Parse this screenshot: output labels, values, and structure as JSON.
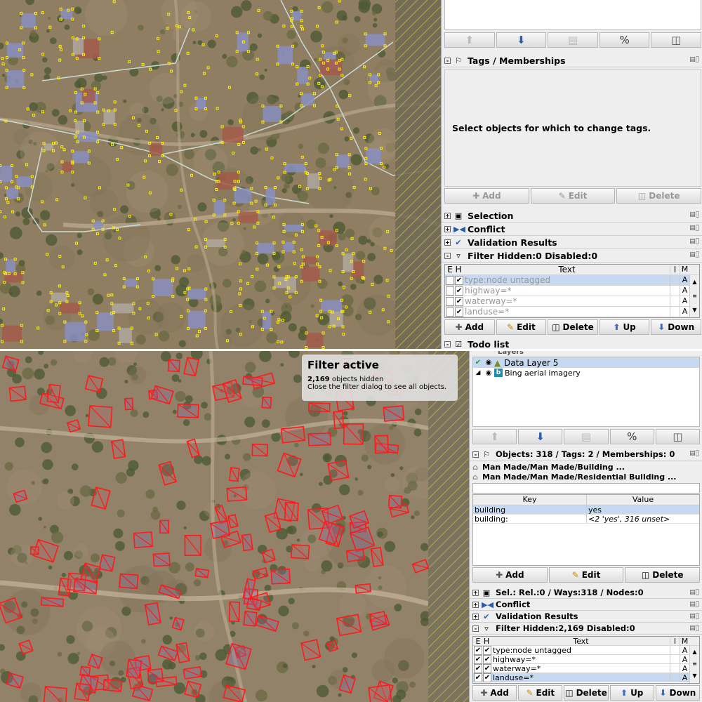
{
  "top": {
    "toolbar": [
      "up-arrow",
      "down-arrow",
      "merge",
      "percent",
      "trash"
    ],
    "tags_header": "Tags / Memberships",
    "tags_message": "Select objects for which to change tags.",
    "tags_buttons": {
      "add": "Add",
      "edit": "Edit",
      "delete": "Delete"
    },
    "dialogs": [
      {
        "label": "Selection",
        "icon": "selection-icon"
      },
      {
        "label": "Conflict",
        "icon": "conflict-icon"
      },
      {
        "label": "Validation Results",
        "icon": "check-icon"
      },
      {
        "label": "Filter Hidden:0 Disabled:0",
        "icon": "filter-icon"
      }
    ],
    "filter_cols": {
      "e": "E",
      "h": "H",
      "text": "Text",
      "i": "I",
      "m": "M"
    },
    "filters": [
      {
        "text": "type:node untagged",
        "m": "A"
      },
      {
        "text": "highway=*",
        "m": "A"
      },
      {
        "text": "waterway=*",
        "m": "A"
      },
      {
        "text": "landuse=*",
        "m": "A"
      }
    ],
    "filter_buttons": {
      "add": "Add",
      "edit": "Edit",
      "delete": "Delete",
      "up": "Up",
      "down": "Down"
    },
    "todo": "Todo list"
  },
  "bottom": {
    "tooltip": {
      "title": "Filter active",
      "count": "2,169",
      "count_suffix": "objects hidden",
      "hint": "Close the filter dialog to see all objects."
    },
    "layers_header": "Layers",
    "layers": [
      {
        "name": "Data Layer 5"
      },
      {
        "name": "Bing aerial imagery"
      }
    ],
    "toolbar": [
      "up-arrow",
      "down-arrow",
      "merge",
      "percent",
      "trash"
    ],
    "objects_header": "Objects: 318 / Tags: 2 / Memberships: 0",
    "presets": [
      "Man Made/Man Made/Building ...",
      "Man Made/Man Made/Residential Building ..."
    ],
    "tag_cols": {
      "key": "Key",
      "value": "Value"
    },
    "tags": [
      {
        "key": "building",
        "value": "yes"
      },
      {
        "key": "building:",
        "value": "<2 'yes', 316 unset>"
      }
    ],
    "tags_buttons": {
      "add": "Add",
      "edit": "Edit",
      "delete": "Delete"
    },
    "dialogs": [
      {
        "label": "Sel.: Rel.:0 / Ways:318 / Nodes:0",
        "icon": "selection-icon"
      },
      {
        "label": "Conflict",
        "icon": "conflict-icon"
      },
      {
        "label": "Validation Results",
        "icon": "check-icon"
      },
      {
        "label": "Filter Hidden:2,169 Disabled:0",
        "icon": "filter-icon"
      }
    ],
    "filter_cols": {
      "e": "E",
      "h": "H",
      "text": "Text",
      "i": "I",
      "m": "M"
    },
    "filters": [
      {
        "text": "type:node untagged",
        "m": "A"
      },
      {
        "text": "highway=*",
        "m": "A"
      },
      {
        "text": "waterway=*",
        "m": "A"
      },
      {
        "text": "landuse=*",
        "m": "A"
      }
    ],
    "filter_buttons": {
      "add": "Add",
      "edit": "Edit",
      "delete": "Delete",
      "up": "Up",
      "down": "Down"
    }
  }
}
